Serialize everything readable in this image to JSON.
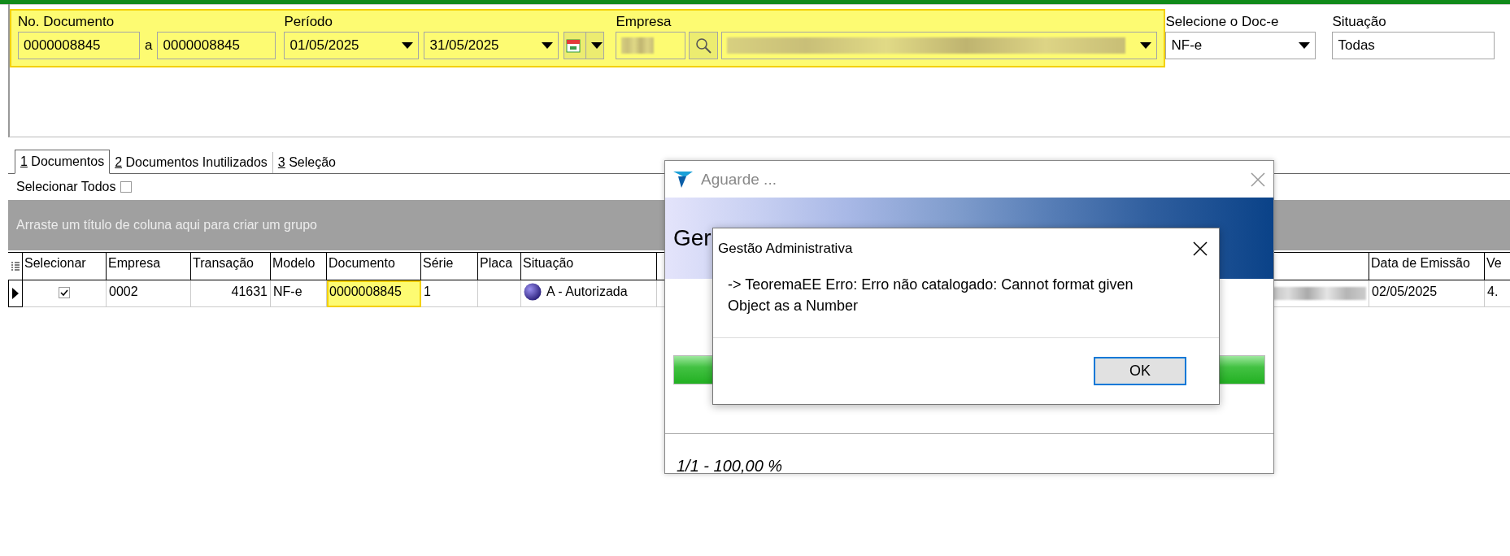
{
  "filters": {
    "highlighted": true,
    "doc_number": {
      "label": "No. Documento",
      "from": "0000008845",
      "separator": "a",
      "to": "0000008845"
    },
    "period": {
      "label": "Período",
      "from": "01/05/2025",
      "to": "31/05/2025"
    },
    "company": {
      "label": "Empresa",
      "code_redacted": true,
      "name_redacted": true
    },
    "doc_type": {
      "label": "Selecione o Doc-e",
      "value": "NF-e"
    },
    "status": {
      "label": "Situação",
      "value": "Todas"
    }
  },
  "tabs": [
    {
      "hotkey": "1",
      "label": "Documentos",
      "selected": true
    },
    {
      "hotkey": "2",
      "label": "Documentos Inutilizados",
      "selected": false
    },
    {
      "hotkey": "3",
      "label": "Seleção",
      "selected": false
    }
  ],
  "select_all": {
    "label": "Selecionar Todos",
    "checked": false
  },
  "group_panel": {
    "hint": "Arraste um título de coluna aqui para criar um grupo"
  },
  "table": {
    "columns": [
      {
        "label": "Selecionar",
        "kind": "check"
      },
      {
        "label": "Empresa",
        "kind": "text"
      },
      {
        "label": "Transação",
        "kind": "number"
      },
      {
        "label": "Modelo",
        "kind": "text"
      },
      {
        "label": "Documento",
        "kind": "text"
      },
      {
        "label": "Série",
        "kind": "text"
      },
      {
        "label": "Placa",
        "kind": "text"
      },
      {
        "label": "Situação",
        "kind": "status"
      },
      {
        "kind": "covered"
      },
      {
        "label": "Data de Emissão",
        "kind": "text"
      },
      {
        "label": "Ve",
        "kind": "text"
      }
    ],
    "rows": [
      {
        "current": true,
        "cells": [
          {
            "checked": true
          },
          {
            "text": "0002"
          },
          {
            "text": "41631"
          },
          {
            "text": "NF-e"
          },
          {
            "text": "0000008845",
            "highlighted": true
          },
          {
            "text": "1"
          },
          {},
          {
            "text": "A - Autorizada"
          },
          {
            "redacted": true
          },
          {
            "text": "02/05/2025"
          },
          {
            "text": "4."
          }
        ]
      }
    ]
  },
  "progress_dialog": {
    "title": "Aguarde ...",
    "banner_text": "Ger",
    "level": 1,
    "status": "1/1 - 100,00 %"
  },
  "message_box": {
    "title": "Gestão Administrativa",
    "message": "-> TeoremaEE Erro: Erro não catalogado: Cannot format given Object as a Number",
    "button": "OK"
  }
}
